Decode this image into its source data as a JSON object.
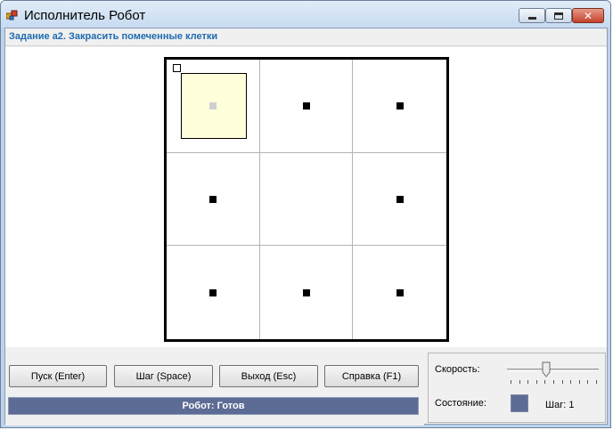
{
  "window": {
    "title": "Исполнитель Робот",
    "minimize_symbol": "",
    "maximize_symbol": "",
    "close_symbol": "✕"
  },
  "task": {
    "label": "Задание а2. Закрасить помеченные клетки"
  },
  "field": {
    "rows": 3,
    "cols": 3,
    "robot_cell": [
      0,
      0
    ],
    "marked_cells": [
      [
        0,
        0
      ],
      [
        0,
        1
      ],
      [
        0,
        2
      ],
      [
        1,
        0
      ],
      [
        1,
        2
      ],
      [
        2,
        0
      ],
      [
        2,
        1
      ],
      [
        2,
        2
      ]
    ],
    "robot_fill": "#ffffdc",
    "marker_color": "#000000",
    "marker_under_robot_color": "#cfcfcf"
  },
  "buttons": {
    "run": "Пуск (Enter)",
    "step": "Шаг (Space)",
    "exit": "Выход (Esc)",
    "help": "Справка (F1)"
  },
  "status": {
    "text": "Робот: Готов",
    "color": "#5c6c95"
  },
  "panel": {
    "speed_label": "Скорость:",
    "speed_value": 0.42,
    "speed_ticks": 11,
    "state_label": "Состояние:",
    "state_color": "#5c6c95",
    "step_text": "Шаг: 1"
  },
  "icons": {
    "app": "robot-app-icon",
    "minimize": "minimize-icon",
    "maximize": "maximize-icon",
    "close": "close-icon"
  }
}
